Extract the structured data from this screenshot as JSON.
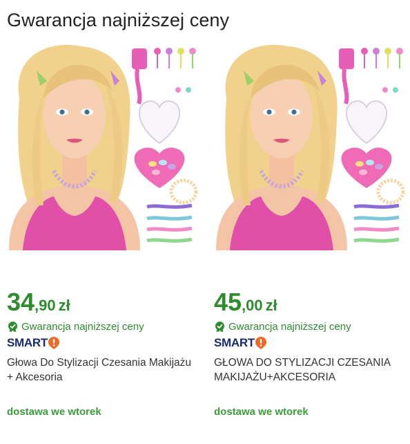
{
  "section": {
    "title": "Gwarancja najniższej ceny"
  },
  "colors": {
    "price": "#2e8b2e",
    "smart_navy": "#1a2b6d",
    "smart_orange": "#f26722",
    "delivery": "#3a9d3a"
  },
  "products": [
    {
      "price_int": "34",
      "price_frac": ",90",
      "currency": "zł",
      "guarantee": "Gwarancja najniższej ceny",
      "smart": "SMART",
      "title": "Głowa Do Stylizacji Czesania Makijażu + Akcesoria",
      "delivery": "dostawa we wtorek",
      "image_icon": "styling-head-doll-image"
    },
    {
      "price_int": "45",
      "price_frac": ",00",
      "currency": "zł",
      "guarantee": "Gwarancja najniższej ceny",
      "smart": "SMART",
      "title": "GŁOWA DO STYLIZACJI CZESANIA MAKIJAŻU+AKCESORIA",
      "delivery": "dostawa we wtorek",
      "image_icon": "styling-head-doll-image"
    }
  ]
}
